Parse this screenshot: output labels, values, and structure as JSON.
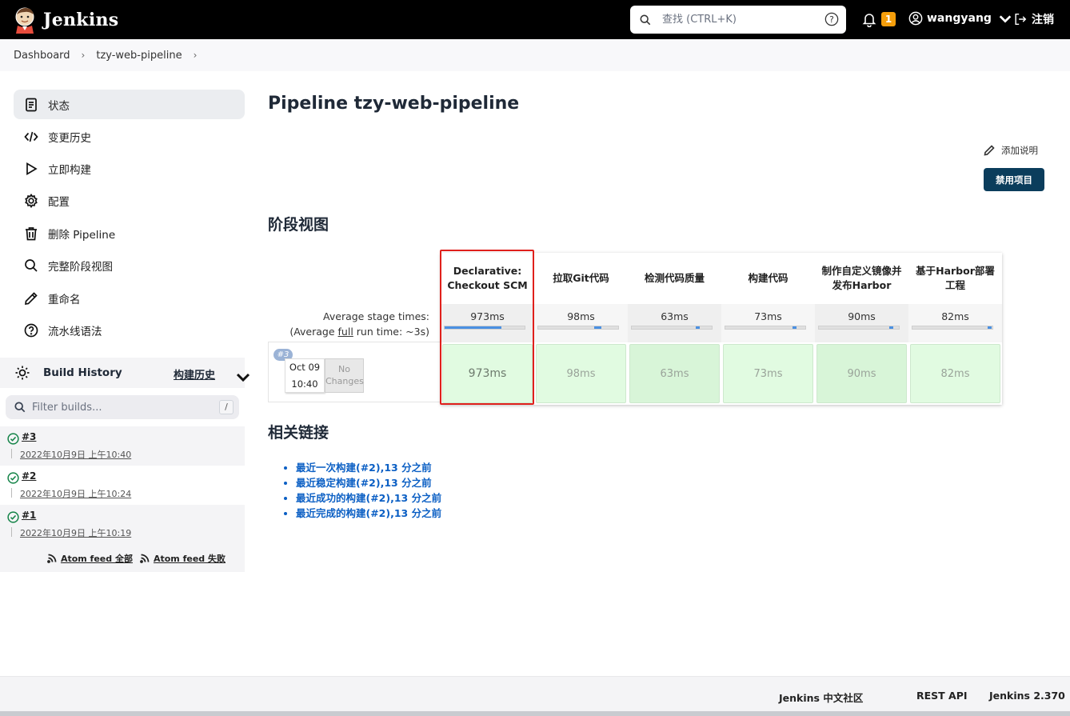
{
  "header": {
    "title": "Jenkins",
    "search_placeholder": "查找 (CTRL+K)",
    "notifications_count": "1",
    "user": "wangyang",
    "logout": "注销"
  },
  "breadcrumb": [
    "Dashboard",
    "tzy-web-pipeline"
  ],
  "sidebar": {
    "tasks": [
      "状态",
      "变更历史",
      "立即构建",
      "配置",
      "删除 Pipeline",
      "完整阶段视图",
      "重命名",
      "流水线语法"
    ],
    "build_history": {
      "title": "Build History",
      "trend": "构建历史",
      "filter_placeholder": "Filter builds...",
      "shortcut": "/",
      "builds": [
        {
          "num": "#3",
          "date": "2022年10月9日 上午10:40"
        },
        {
          "num": "#2",
          "date": "2022年10月9日 上午10:24"
        },
        {
          "num": "#1",
          "date": "2022年10月9日 上午10:19"
        }
      ],
      "feeds": [
        "Atom feed 全部",
        "Atom feed 失败"
      ]
    }
  },
  "main": {
    "title": "Pipeline tzy-web-pipeline",
    "add_description": "添加说明",
    "disable_button": "禁用项目",
    "stage_view_title": "阶段视图",
    "avg_label_line1": "Average stage times:",
    "avg_label_line2_prefix": "(Average ",
    "avg_label_line2_link": "full",
    "avg_label_line2_suffix": " run time: ~3s)",
    "stages": [
      {
        "name": "Declarative: Checkout SCM",
        "avg": "973ms",
        "run": "973ms",
        "share": 0.71
      },
      {
        "name": "拉取Git代码",
        "avg": "98ms",
        "run": "98ms",
        "share": 0.07
      },
      {
        "name": "检测代码质量",
        "avg": "63ms",
        "run": "63ms",
        "share": 0.05
      },
      {
        "name": "构建代码",
        "avg": "73ms",
        "run": "73ms",
        "share": 0.05
      },
      {
        "name": "制作自定义镜像并发布Harbor",
        "avg": "90ms",
        "run": "90ms",
        "share": 0.07
      },
      {
        "name": "基于Harbor部署工程",
        "avg": "82ms",
        "run": "82ms",
        "share": 0.06
      }
    ],
    "run": {
      "badge": "#3",
      "date": "Oct 09",
      "time": "10:40",
      "changes": "No Changes"
    },
    "related_title": "相关链接",
    "related_links": [
      "最近一次构建(#2),13 分之前",
      "最近稳定构建(#2),13 分之前",
      "最近成功的构建(#2),13 分之前",
      "最近完成的构建(#2),13 分之前"
    ]
  },
  "footer": {
    "community": "Jenkins 中文社区",
    "rest_api": "REST API",
    "version": "Jenkins 2.370"
  }
}
